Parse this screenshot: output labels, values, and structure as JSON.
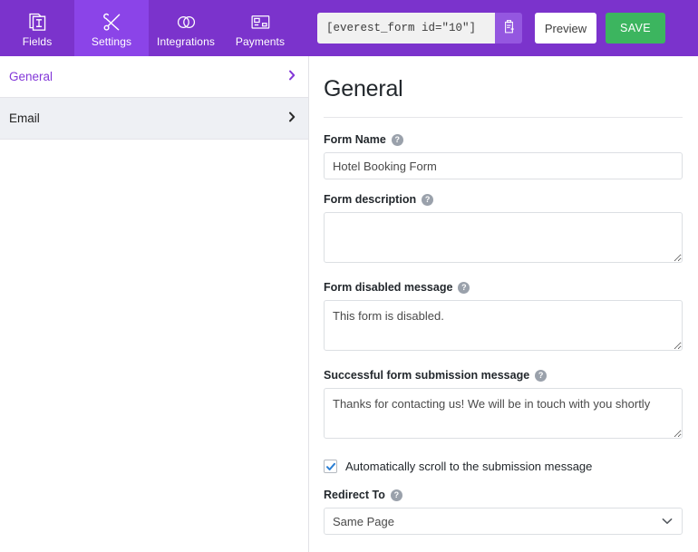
{
  "topbar": {
    "tabs": [
      {
        "label": "Fields",
        "icon": "document-text-icon",
        "active": false
      },
      {
        "label": "Settings",
        "icon": "wrench-screwdriver-icon",
        "active": true
      },
      {
        "label": "Integrations",
        "icon": "overlapping-circles-icon",
        "active": false
      },
      {
        "label": "Payments",
        "icon": "credit-card-icon",
        "active": false
      }
    ],
    "shortcode_value": "[everest_form id=\"10\"]",
    "shortcode_placeholder": "[everest_form id=\"10\"]",
    "copy_icon": "clipboard-copy-icon",
    "preview_label": "Preview",
    "save_label": "SAVE",
    "colors": {
      "bar": "#7b33cc",
      "active_tab": "#8b44e8",
      "save": "#3cb55f"
    }
  },
  "sidebar": {
    "items": [
      {
        "label": "General",
        "active": true,
        "chevron": "chevron-right-icon"
      },
      {
        "label": "Email",
        "active": false,
        "chevron": "chevron-right-icon"
      }
    ]
  },
  "main": {
    "title": "General",
    "fields": {
      "form_name": {
        "label": "Form Name",
        "help": "?",
        "value": "Hotel Booking Form",
        "placeholder": "Form Name"
      },
      "form_description": {
        "label": "Form description",
        "help": "?",
        "value": "",
        "placeholder": ""
      },
      "form_disabled_message": {
        "label": "Form disabled message",
        "help": "?",
        "value": "This form is disabled.",
        "placeholder": ""
      },
      "success_message": {
        "label": "Successful form submission message",
        "help": "?",
        "value": "Thanks for contacting us! We will be in touch with you shortly",
        "placeholder": ""
      },
      "auto_scroll": {
        "label": "Automatically scroll to the submission message",
        "checked": true
      },
      "redirect_to": {
        "label": "Redirect To",
        "help": "?",
        "value": "Same Page",
        "options": [
          "Same Page"
        ]
      }
    },
    "colors": {
      "accent": "#8338d8",
      "checkbox_check": "#2b7fd4"
    }
  }
}
